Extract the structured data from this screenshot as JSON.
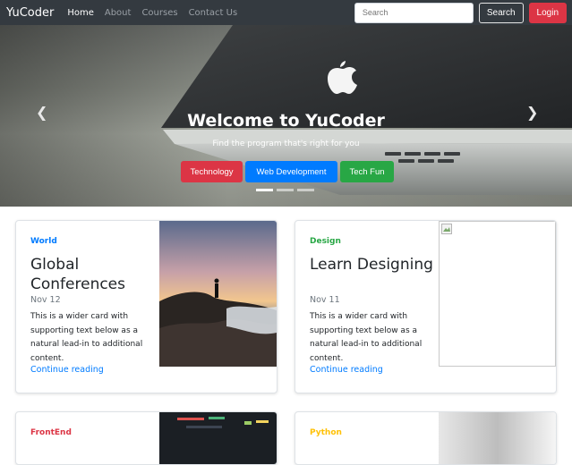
{
  "navbar": {
    "brand": "YuCoder",
    "links": [
      "Home",
      "About",
      "Courses",
      "Contact Us"
    ],
    "search_placeholder": "Search",
    "search_button": "Search",
    "login_button": "Login"
  },
  "carousel": {
    "title": "Welcome to YuCoder",
    "subtitle": "Find the program that's right for you",
    "buttons": [
      "Technology",
      "Web Development",
      "Tech Fun"
    ],
    "prev_icon": "chevron-left-icon",
    "next_icon": "chevron-right-icon",
    "slide_count": 3,
    "active_slide": 1
  },
  "cards": [
    {
      "category": "World",
      "category_color": "#007bff",
      "title": "Global Conferences",
      "date": "Nov 12",
      "text": "This is a wider card with supporting text below as a natural lead-in to additional content.",
      "link": "Continue reading"
    },
    {
      "category": "Design",
      "category_color": "#28a745",
      "title": "Learn Designing",
      "date": "Nov 11",
      "text": "This is a wider card with supporting text below as a natural lead-in to additional content.",
      "link": "Continue reading"
    },
    {
      "category": "FrontEnd",
      "category_color": "#dc3545"
    },
    {
      "category": "Python",
      "category_color": "#ffc107"
    }
  ]
}
